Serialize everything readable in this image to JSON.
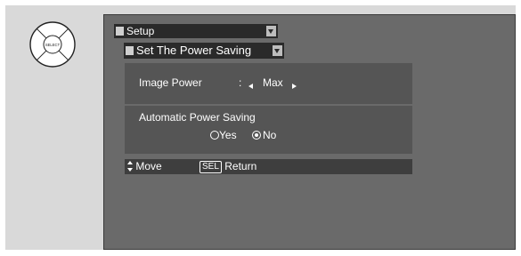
{
  "remote": {
    "center_label": "SELECT"
  },
  "menu": {
    "setup_label": "Setup",
    "submenu_label": "Set The Power Saving"
  },
  "image_power": {
    "label": "Image Power",
    "separator": ":",
    "value": "Max"
  },
  "auto_power_saving": {
    "label": "Automatic Power Saving",
    "options": [
      "Yes",
      "No"
    ],
    "selected": "No"
  },
  "status_bar": {
    "move_label": "Move",
    "sel_key_label": "SEL",
    "return_label": "Return"
  }
}
